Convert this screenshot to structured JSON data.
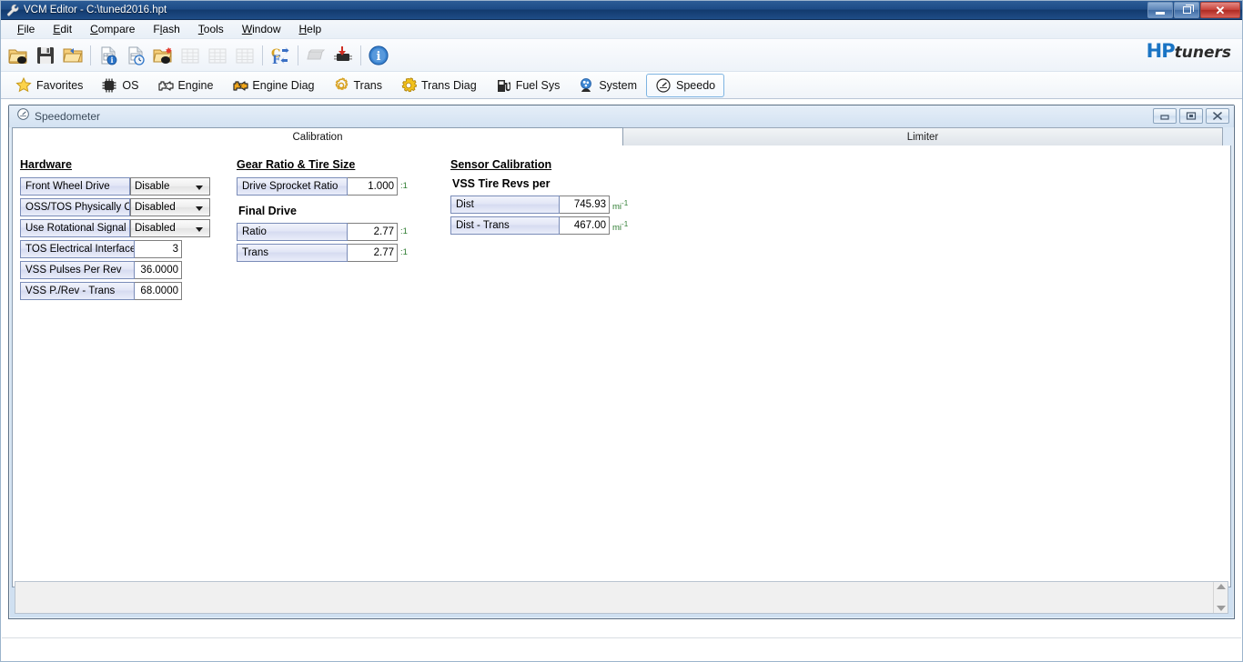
{
  "window": {
    "title": "VCM Editor - C:\\tuned2016.hpt",
    "title_icon": "wrench-icon",
    "buttons": {
      "minimize": "minimize-button",
      "restore": "restore-button",
      "close": "close-button"
    }
  },
  "menu": {
    "items": [
      {
        "label": "File",
        "accel": "F"
      },
      {
        "label": "Edit",
        "accel": "E"
      },
      {
        "label": "Compare",
        "accel": "C"
      },
      {
        "label": "Flash",
        "accel": "l"
      },
      {
        "label": "Tools",
        "accel": "T"
      },
      {
        "label": "Window",
        "accel": "W"
      },
      {
        "label": "Help",
        "accel": "H"
      }
    ]
  },
  "toolbar": {
    "logo_hp": "HP",
    "logo_tuners": "tuners",
    "buttons": [
      {
        "name": "open-file-icon",
        "enabled": true
      },
      {
        "name": "save-file-icon",
        "enabled": true
      },
      {
        "name": "open-recent-icon",
        "enabled": true
      },
      {
        "sep": true
      },
      {
        "name": "file-info-icon",
        "enabled": true
      },
      {
        "name": "file-history-icon",
        "enabled": true
      },
      {
        "name": "open-tune-icon",
        "enabled": true
      },
      {
        "name": "compare-table-icon",
        "enabled": false
      },
      {
        "name": "table-icon",
        "enabled": false
      },
      {
        "name": "table-graph-icon",
        "enabled": false
      },
      {
        "sep": true
      },
      {
        "name": "units-convert-icon",
        "enabled": true
      },
      {
        "sep": true
      },
      {
        "name": "read-ecu-icon",
        "enabled": false
      },
      {
        "name": "write-ecu-icon",
        "enabled": true
      },
      {
        "sep": true
      },
      {
        "name": "info-icon",
        "enabled": true
      }
    ]
  },
  "categories": [
    {
      "label": "Favorites",
      "icon": "star-icon",
      "selected": false
    },
    {
      "label": "OS",
      "icon": "chip-icon",
      "selected": false
    },
    {
      "label": "Engine",
      "icon": "engine-icon",
      "selected": false
    },
    {
      "label": "Engine Diag",
      "icon": "engine-warning-icon",
      "selected": false
    },
    {
      "label": "Trans",
      "icon": "gear-icon",
      "selected": false
    },
    {
      "label": "Trans Diag",
      "icon": "gear-warning-icon",
      "selected": false
    },
    {
      "label": "Fuel Sys",
      "icon": "fuel-pump-icon",
      "selected": false
    },
    {
      "label": "System",
      "icon": "system-icon",
      "selected": false
    },
    {
      "label": "Speedo",
      "icon": "speedometer-icon",
      "selected": true
    }
  ],
  "child_window": {
    "title": "Speedometer",
    "icon": "speedometer-icon",
    "buttons": {
      "minimize": "minimize-button",
      "restore": "restore-button",
      "close": "close-button"
    }
  },
  "tabs": [
    {
      "label": "Calibration",
      "active": true
    },
    {
      "label": "Limiter",
      "active": false
    }
  ],
  "panel": {
    "hardware": {
      "title": "Hardware",
      "rows": [
        {
          "label": "Front Wheel Drive",
          "value": "Disable",
          "type": "combo"
        },
        {
          "label": "OSS/TOS Physically Co",
          "value": "Disabled",
          "type": "combo"
        },
        {
          "label": "Use Rotational Signal",
          "value": "Disabled",
          "type": "combo"
        },
        {
          "label": "TOS Electrical Interface",
          "value": "3",
          "type": "number",
          "unit": ""
        },
        {
          "label": "VSS Pulses Per Rev",
          "value": "36.0000",
          "type": "number",
          "unit": ""
        },
        {
          "label": "VSS P./Rev - Trans",
          "value": "68.0000",
          "type": "number",
          "unit": ""
        }
      ]
    },
    "gear_ratio": {
      "title": "Gear Ratio & Tire Size",
      "rows": [
        {
          "label": "Drive Sprocket Ratio",
          "value": "1.000",
          "unit": ":1"
        }
      ],
      "final_drive": {
        "title": "Final Drive",
        "rows": [
          {
            "label": "Ratio",
            "value": "2.77",
            "unit": ":1"
          },
          {
            "label": "Trans",
            "value": "2.77",
            "unit": ":1"
          }
        ]
      }
    },
    "sensor_calibration": {
      "title": "Sensor Calibration",
      "subtitle": "VSS Tire Revs per",
      "rows": [
        {
          "label": "Dist",
          "value": "745.93",
          "unit": "mi",
          "unit_sup": "-1"
        },
        {
          "label": "Dist - Trans",
          "value": "467.00",
          "unit": "mi",
          "unit_sup": "-1"
        }
      ]
    }
  },
  "colors": {
    "titlebar": "#1d4c87",
    "label_bg": "#e2e6f6",
    "label_border": "#7a8cb8",
    "unit_green": "#2f7d32",
    "accent_blue": "#1a74c4",
    "tab_active_bg": "#ffffff"
  }
}
